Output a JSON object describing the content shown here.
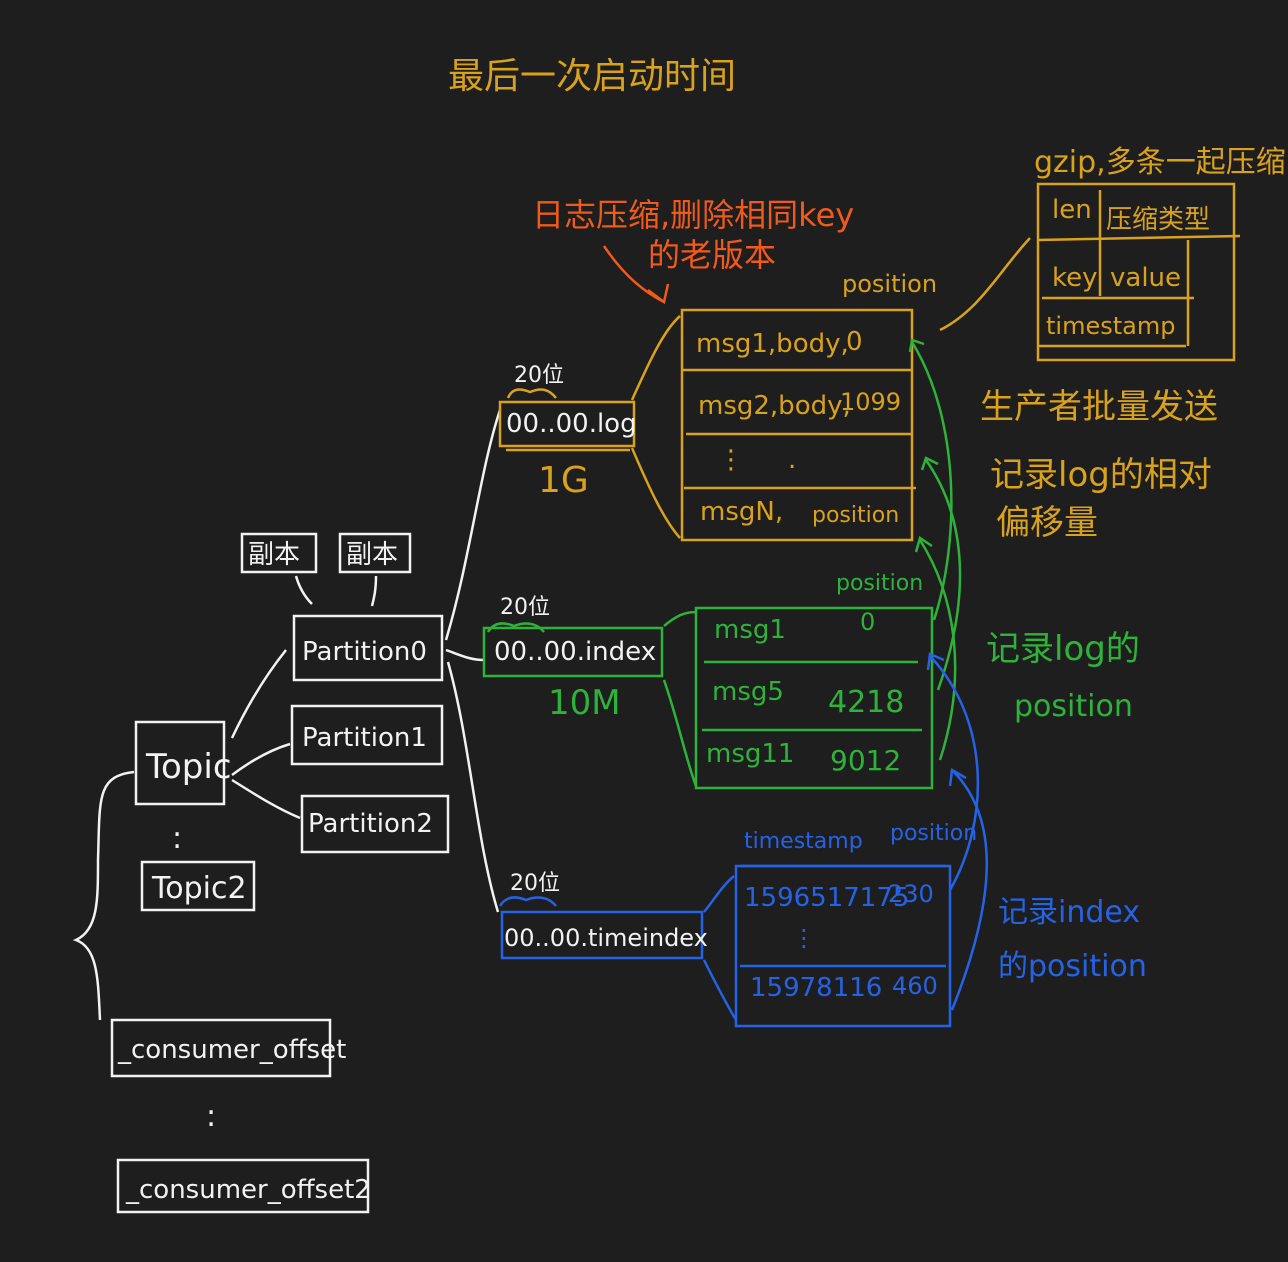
{
  "colors": {
    "background": "#1e1e1e",
    "white": "#f2f2f2",
    "yellow": "#d9a21b",
    "orange": "#f05a1a",
    "green": "#2eb33a",
    "blue": "#2563e6"
  },
  "top_note": "最后一次启动时间",
  "orange_note": {
    "line1": "日志压缩,删除相同key",
    "line2": "的老版本"
  },
  "gzip_note": "gzip,多条一起压缩",
  "batch_note": "生产者批量发送",
  "log_offset_note": {
    "line1": "记录log的相对",
    "line2": "偏移量"
  },
  "log_position_note": {
    "line1": "记录log的",
    "line2": "position"
  },
  "index_position_note": {
    "line1": "记录index",
    "line2": "的position"
  },
  "topics": {
    "topic": "Topic",
    "dots": ":",
    "topic2": "Topic2"
  },
  "consumer": {
    "offset": "_consumer_offset",
    "dots": ":",
    "offset2": "_consumer_offset2"
  },
  "partitions": [
    "Partition0",
    "Partition1",
    "Partition2"
  ],
  "replicas": [
    "副本",
    "副本"
  ],
  "files": {
    "log": {
      "name": "00..00.log",
      "bits": "20位",
      "size": "1G"
    },
    "index": {
      "name": "00..00.index",
      "bits": "20位",
      "size": "10M"
    },
    "timeindex": {
      "name": "00..00.timeindex",
      "bits": "20位"
    }
  },
  "log_table": {
    "header": "position",
    "rows": [
      {
        "msg": "msg1,body,",
        "pos": "0"
      },
      {
        "msg": "msg2,body,",
        "pos": "1099"
      },
      {
        "msg": "⋮",
        "pos": "."
      },
      {
        "msg": "msgN,",
        "pos": "position"
      }
    ]
  },
  "index_table": {
    "header": "position",
    "rows": [
      {
        "msg": "msg1",
        "pos": "0"
      },
      {
        "msg": "msg5",
        "pos": "4218"
      },
      {
        "msg": "msg11",
        "pos": "9012"
      }
    ]
  },
  "time_table": {
    "headers": [
      "timestamp",
      "position"
    ],
    "rows": [
      {
        "ts": "1596517175",
        "pos": "230"
      },
      {
        "ts": "⋮",
        "pos": ""
      },
      {
        "ts": "15978116",
        "pos": "460"
      }
    ]
  },
  "record_table": {
    "cells": {
      "len": "len",
      "attr": "压缩类型",
      "key": "key",
      "value": "value",
      "timestamp": "timestamp"
    }
  }
}
